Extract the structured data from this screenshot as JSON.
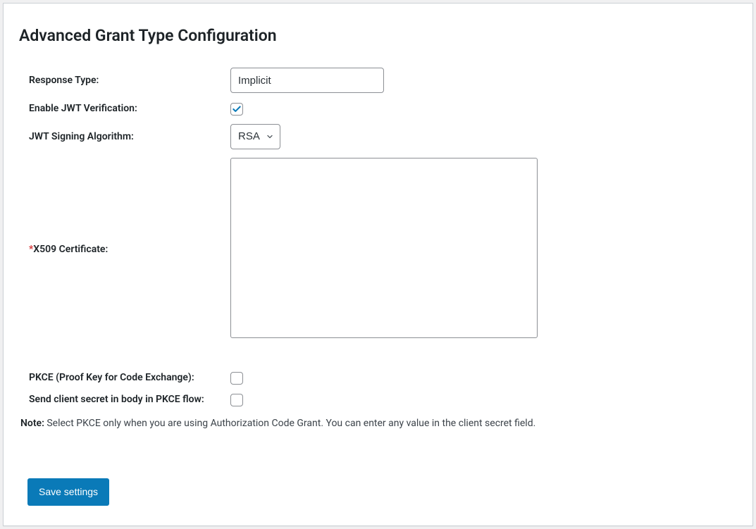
{
  "title": "Advanced Grant Type Configuration",
  "fields": {
    "response_type": {
      "label": "Response Type:",
      "value": "Implicit"
    },
    "enable_jwt": {
      "label": "Enable JWT Verification:",
      "checked": true
    },
    "jwt_alg": {
      "label": "JWT Signing Algorithm:",
      "value": "RSA"
    },
    "x509": {
      "label": "X509 Certificate:",
      "required_prefix": "*",
      "value": ""
    },
    "pkce": {
      "label": "PKCE (Proof Key for Code Exchange):",
      "checked": false
    },
    "client_secret_body": {
      "label": "Send client secret in body in PKCE flow:",
      "checked": false
    }
  },
  "note_label": "Note:",
  "note_text": " Select PKCE only when you are using Authorization Code Grant. You can enter any value in the client secret field.",
  "save_label": "Save settings"
}
